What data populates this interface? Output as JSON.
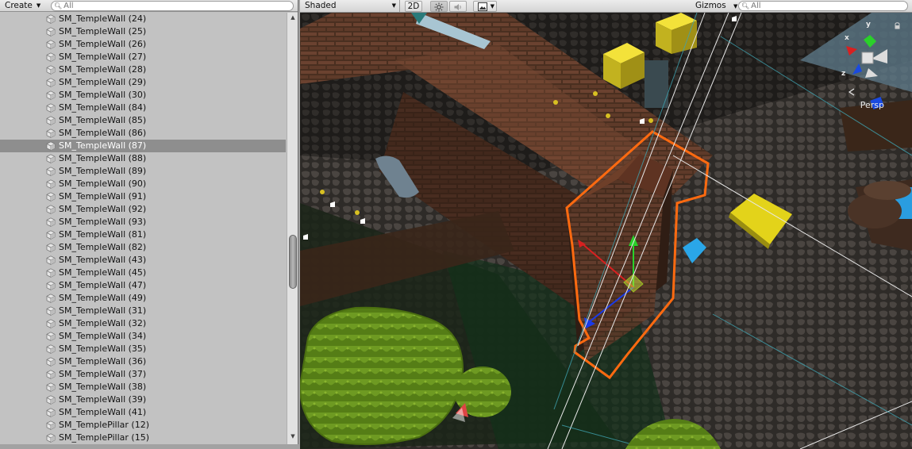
{
  "hierarchy": {
    "create_label": "Create",
    "search": {
      "placeholder": "All",
      "value": ""
    },
    "items": [
      {
        "label": "SM_TempleWall (24)",
        "selected": false
      },
      {
        "label": "SM_TempleWall (25)",
        "selected": false
      },
      {
        "label": "SM_TempleWall (26)",
        "selected": false
      },
      {
        "label": "SM_TempleWall (27)",
        "selected": false
      },
      {
        "label": "SM_TempleWall (28)",
        "selected": false
      },
      {
        "label": "SM_TempleWall (29)",
        "selected": false
      },
      {
        "label": "SM_TempleWall (30)",
        "selected": false
      },
      {
        "label": "SM_TempleWall (84)",
        "selected": false
      },
      {
        "label": "SM_TempleWall (85)",
        "selected": false
      },
      {
        "label": "SM_TempleWall (86)",
        "selected": false
      },
      {
        "label": "SM_TempleWall (87)",
        "selected": true
      },
      {
        "label": "SM_TempleWall (88)",
        "selected": false
      },
      {
        "label": "SM_TempleWall (89)",
        "selected": false
      },
      {
        "label": "SM_TempleWall (90)",
        "selected": false
      },
      {
        "label": "SM_TempleWall (91)",
        "selected": false
      },
      {
        "label": "SM_TempleWall (92)",
        "selected": false
      },
      {
        "label": "SM_TempleWall (93)",
        "selected": false
      },
      {
        "label": "SM_TempleWall (81)",
        "selected": false
      },
      {
        "label": "SM_TempleWall (82)",
        "selected": false
      },
      {
        "label": "SM_TempleWall (43)",
        "selected": false
      },
      {
        "label": "SM_TempleWall (45)",
        "selected": false
      },
      {
        "label": "SM_TempleWall (47)",
        "selected": false
      },
      {
        "label": "SM_TempleWall (49)",
        "selected": false
      },
      {
        "label": "SM_TempleWall (31)",
        "selected": false
      },
      {
        "label": "SM_TempleWall (32)",
        "selected": false
      },
      {
        "label": "SM_TempleWall (34)",
        "selected": false
      },
      {
        "label": "SM_TempleWall (35)",
        "selected": false
      },
      {
        "label": "SM_TempleWall (36)",
        "selected": false
      },
      {
        "label": "SM_TempleWall (37)",
        "selected": false
      },
      {
        "label": "SM_TempleWall (38)",
        "selected": false
      },
      {
        "label": "SM_TempleWall (39)",
        "selected": false
      },
      {
        "label": "SM_TempleWall (41)",
        "selected": false
      },
      {
        "label": "SM_TemplePillar (12)",
        "selected": false
      },
      {
        "label": "SM_TemplePillar (15)",
        "selected": false
      }
    ],
    "item_icon": "gameobject-cube-icon"
  },
  "scene": {
    "shading_mode": "Shaded",
    "mode_2d_label": "2D",
    "lighting_icon": "sun-icon",
    "audio_icon": "speaker-icon",
    "effects_icon": "image-icon",
    "gizmos_label": "Gizmos",
    "search": {
      "placeholder": "All",
      "value": ""
    },
    "projection_label": "Persp",
    "axis_labels": {
      "x": "x",
      "y": "y",
      "z": "z"
    },
    "selection_color": "#ff6a10"
  }
}
